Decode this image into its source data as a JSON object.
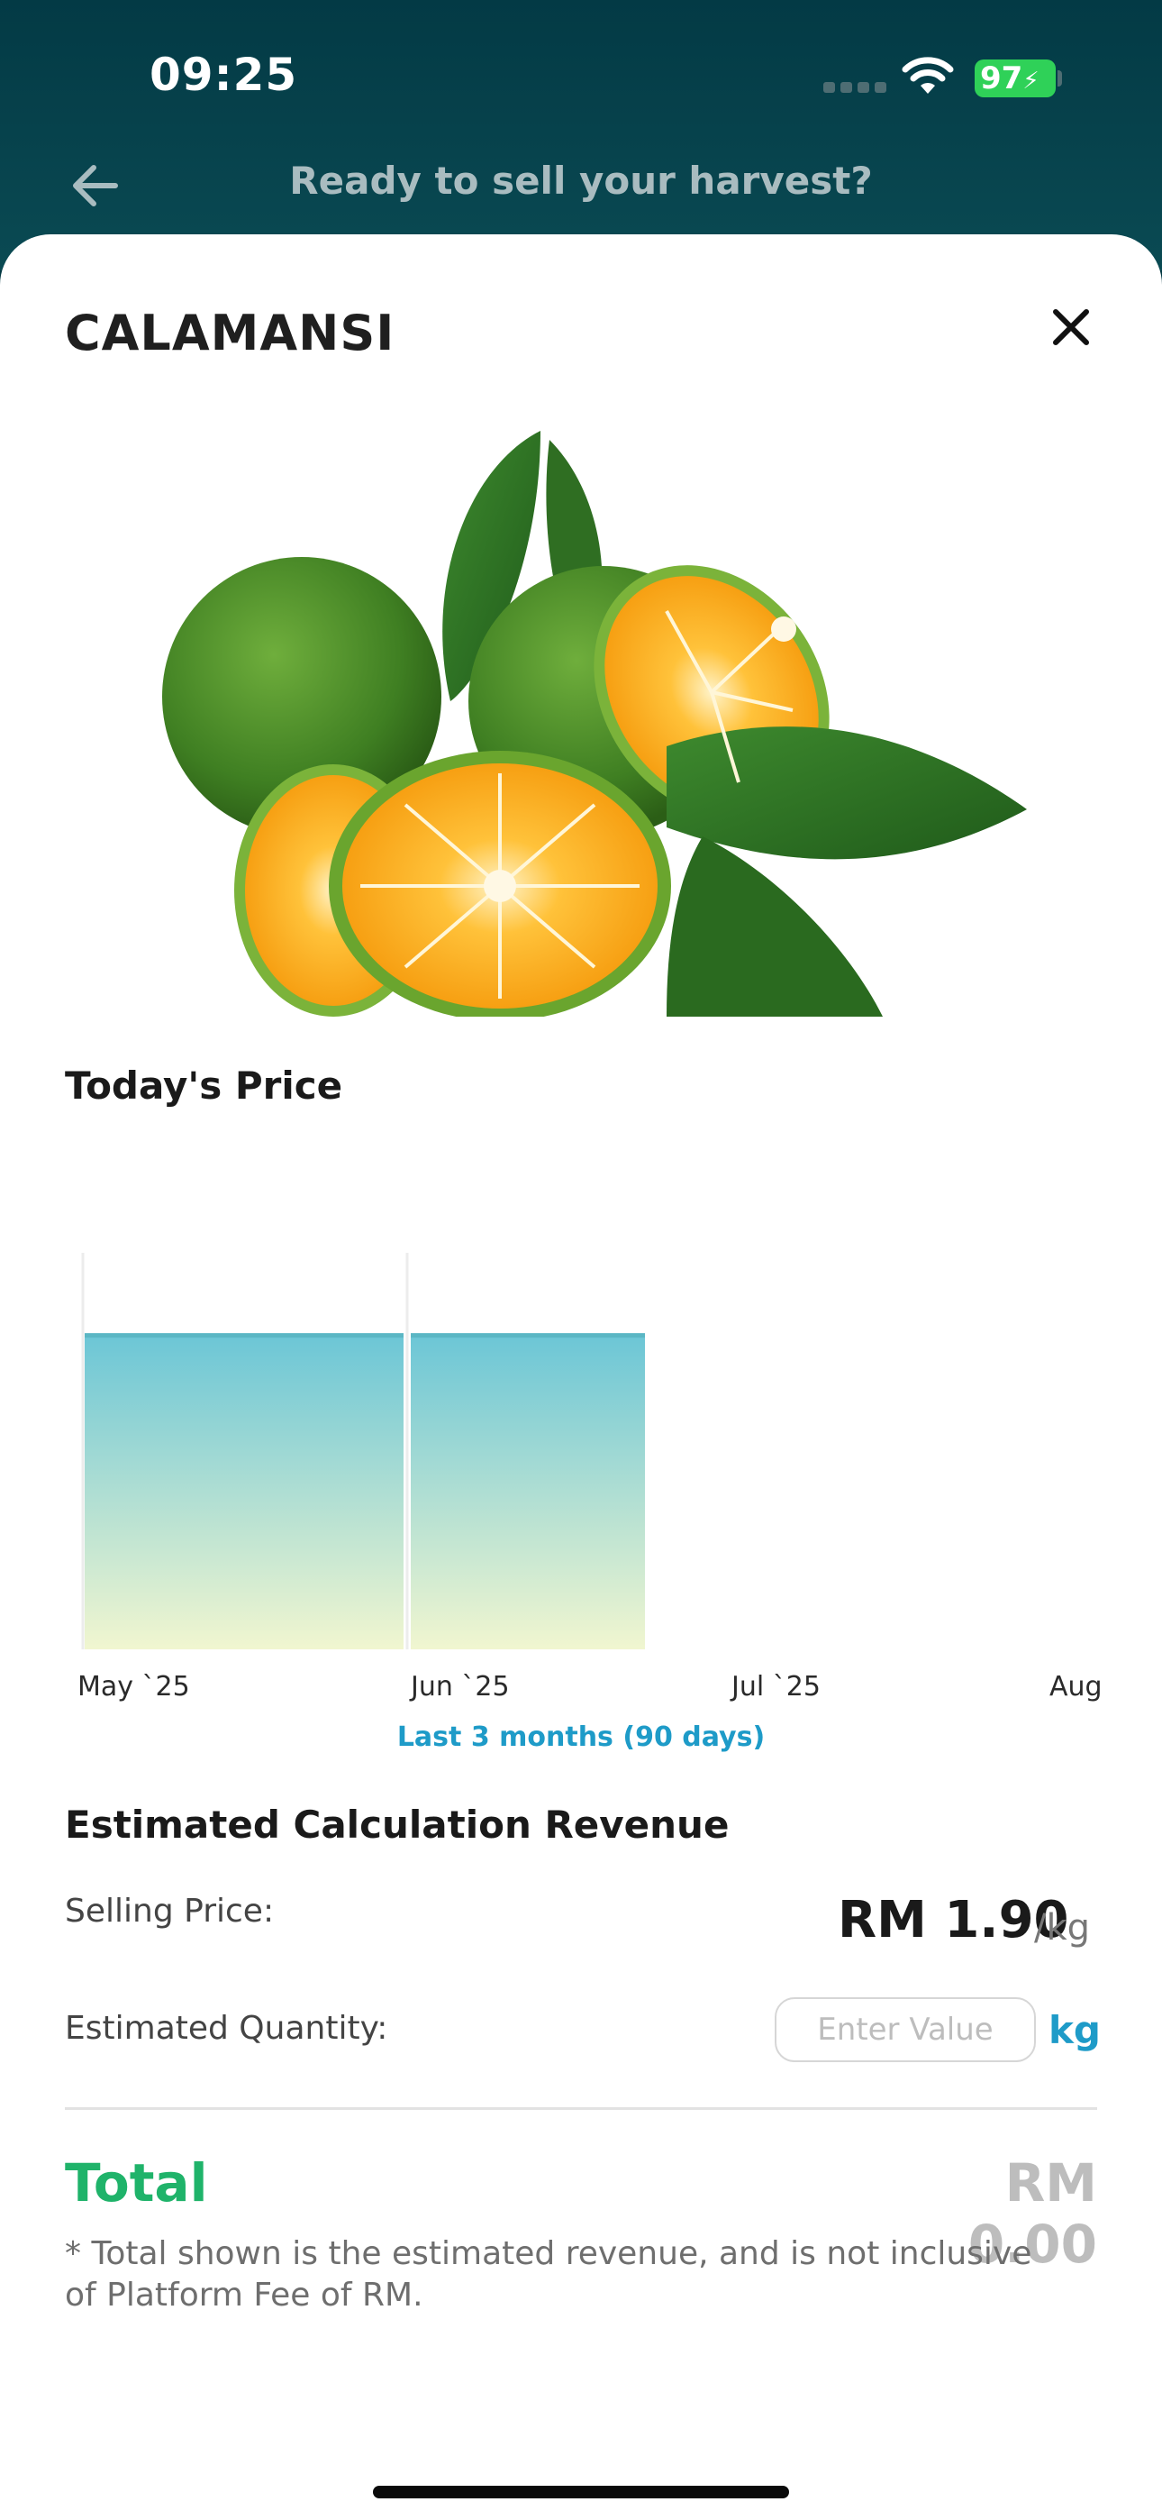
{
  "status_bar": {
    "time": "09:25",
    "battery": "97"
  },
  "header": {
    "title": "Ready to sell your harvest?"
  },
  "product": {
    "name": "CALAMANSI"
  },
  "price_section": {
    "title": "Today's Price"
  },
  "chart_data": {
    "type": "area",
    "x_ticks": [
      "May `25",
      "Jun `25",
      "Jul `25",
      "Aug"
    ],
    "series": [
      {
        "x_start": "May `25",
        "x_end": "Jun `25",
        "value": 1.9
      },
      {
        "x_start": "Jun `25",
        "x_end": "Jul `25",
        "value": 1.9
      }
    ],
    "range_label": "Last 3 months (90 days)",
    "colors": {
      "top": "#6cc6d6",
      "bottom": "#f1f6d0",
      "line": "#5bb7c4"
    }
  },
  "estimate": {
    "title": "Estimated Calculation Revenue",
    "selling_price_label": "Selling Price:",
    "selling_price_value": "RM 1.90",
    "selling_price_unit": "/kg",
    "quantity_label": "Estimated Quantity:",
    "quantity_placeholder": "Enter Value",
    "quantity_value": "",
    "quantity_unit": "kg",
    "total_label": "Total",
    "total_value": "RM 0.00",
    "note": "* Total shown is the estimated revenue, and is not inclusive of Platform Fee of RM."
  },
  "colors": {
    "header_bg": "#033a45",
    "accent_green": "#1fb36a",
    "accent_blue": "#1e9bc8"
  }
}
